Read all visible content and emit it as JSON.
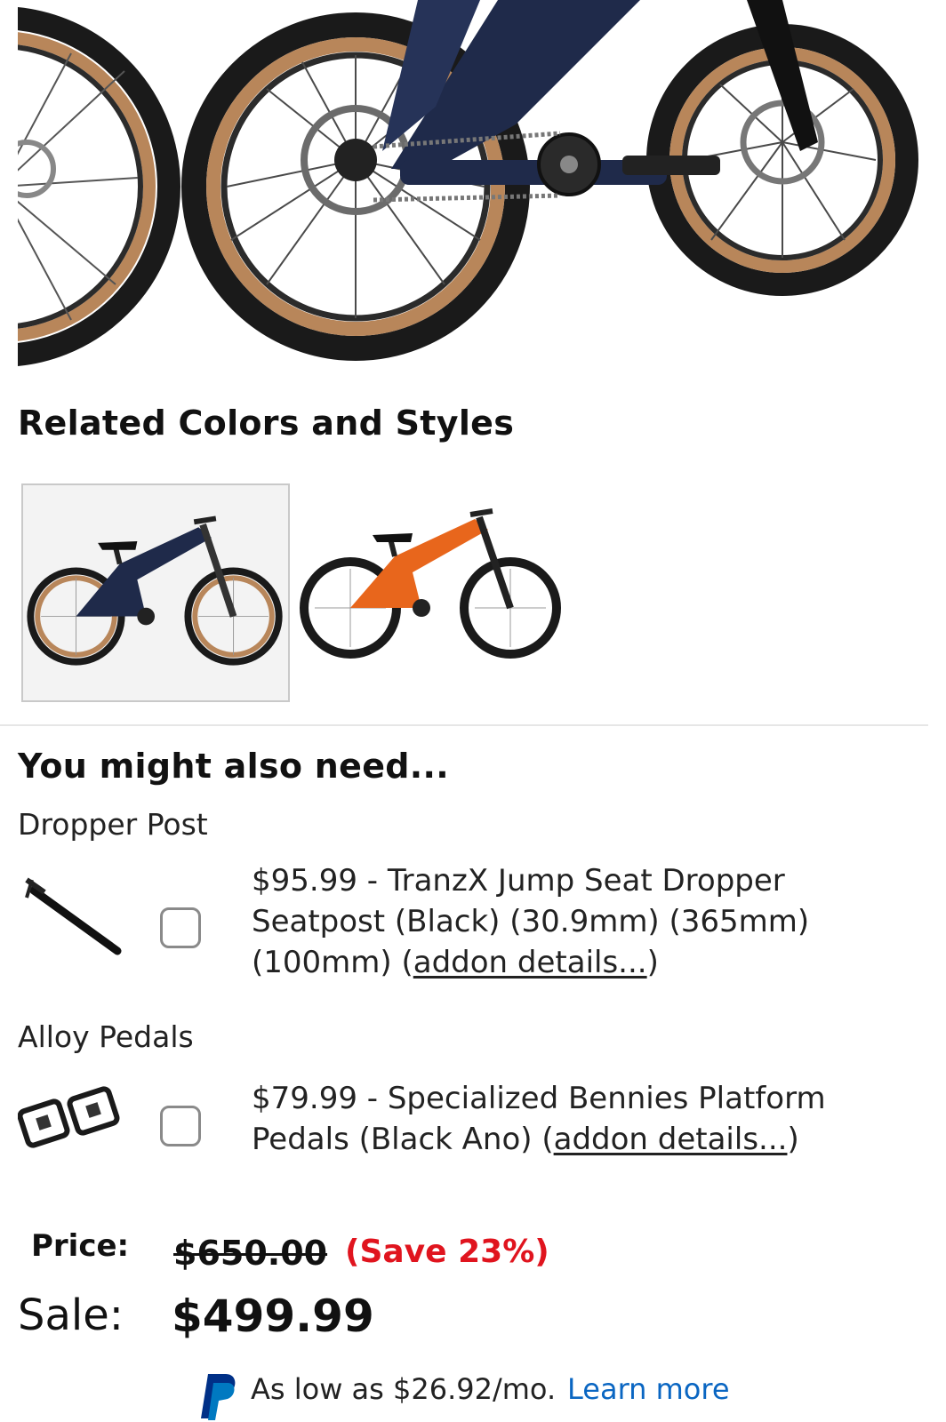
{
  "related": {
    "title": "Related Colors and Styles",
    "swatches": [
      {
        "name": "blue",
        "frame_color": "#1f2a4a",
        "selected": true
      },
      {
        "name": "orange",
        "frame_color": "#e8661c",
        "selected": false
      }
    ]
  },
  "addons": {
    "title": "You might also need...",
    "items": [
      {
        "category": "Dropper Post",
        "description": "$95.99 - TranzX Jump Seat Dropper Seatpost (Black) (30.9mm) (365mm) (100mm) (",
        "link": "addon details...",
        "suffix": ")",
        "checked": false
      },
      {
        "category": "Alloy Pedals",
        "description": "$79.99 - Specialized Bennies Platform Pedals (Black Ano) (",
        "link": "addon details...",
        "suffix": ")",
        "checked": false
      }
    ]
  },
  "pricing": {
    "price_label": "Price:",
    "original_price": "$650.00",
    "save_text": "(Save 23%)",
    "sale_label": "Sale:",
    "sale_price": "$499.99",
    "finance_text": "As low as $26.92/mo.",
    "finance_link": "Learn more"
  },
  "colors": {
    "accent_red": "#e0141e",
    "link_blue": "#0a66c2",
    "tire_tan": "#b8865a",
    "frame_navy": "#1f2a4a"
  }
}
